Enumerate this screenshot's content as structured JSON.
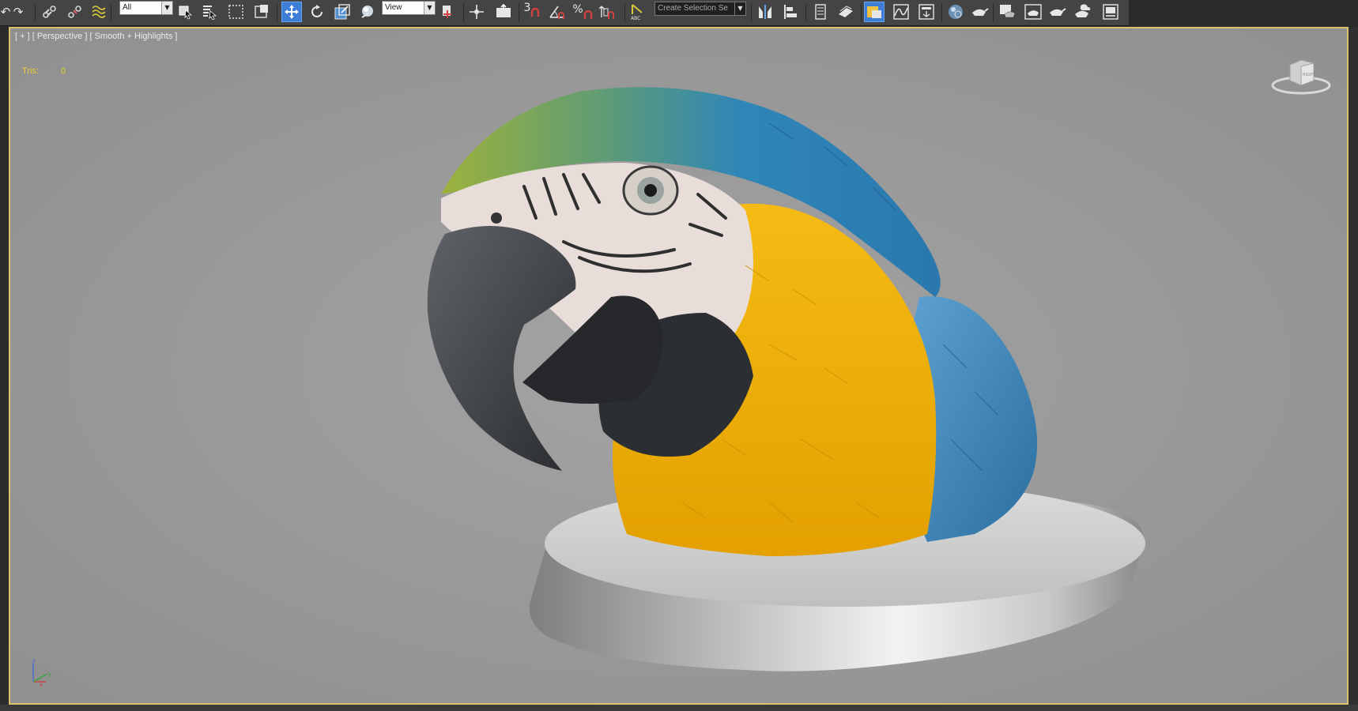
{
  "toolbar": {
    "selection_filter": "All",
    "reference_coord": "View",
    "named_selection_placeholder": "Create Selection Se",
    "snap_toggle_3_label": "3",
    "percent_snap_label": "%",
    "edit_named_label": "ABC"
  },
  "viewport": {
    "label": "[ + ] [ Perspective ] [ Smooth + Highlights ]",
    "stats": {
      "tris_label": "Tris:",
      "tris_value": "0"
    },
    "viewcube_face": "RIGHT",
    "axis": {
      "z": "z",
      "x": "x",
      "y": "y"
    }
  },
  "colors": {
    "toolbar_bg": "#444444",
    "viewport_bg": "#9a9a9a",
    "viewport_border": "#d9c36f",
    "active_button": "#3f7ed6",
    "stats_text": "#e8cf36",
    "macaw_yellow": "#f2b300",
    "macaw_blue": "#2f8cc4",
    "macaw_green": "#8eaa32"
  },
  "icons": [
    "undo-icon",
    "redo-icon",
    "link-icon",
    "unlink-icon",
    "bind-space-warp-icon",
    "select-object-icon",
    "select-by-name-icon",
    "rectangular-selection-icon",
    "window-crossing-icon",
    "select-move-icon",
    "select-rotate-icon",
    "select-scale-icon",
    "select-place-icon",
    "use-pivot-center-icon",
    "select-manipulate-icon",
    "keyboard-shortcut-icon",
    "snaps-toggle-icon",
    "angle-snap-icon",
    "percent-snap-icon",
    "spinner-snap-icon",
    "edit-named-selection-icon",
    "mirror-icon",
    "align-icon",
    "layer-explorer-icon",
    "toggle-ribbon-icon",
    "scene-explorer-icon",
    "curve-editor-icon",
    "schematic-view-icon",
    "material-editor-icon",
    "render-setup-icon",
    "rendered-frame-window-icon",
    "render-production-icon",
    "render-iterative-icon",
    "render-cloud-icon",
    "render-online-icon"
  ]
}
